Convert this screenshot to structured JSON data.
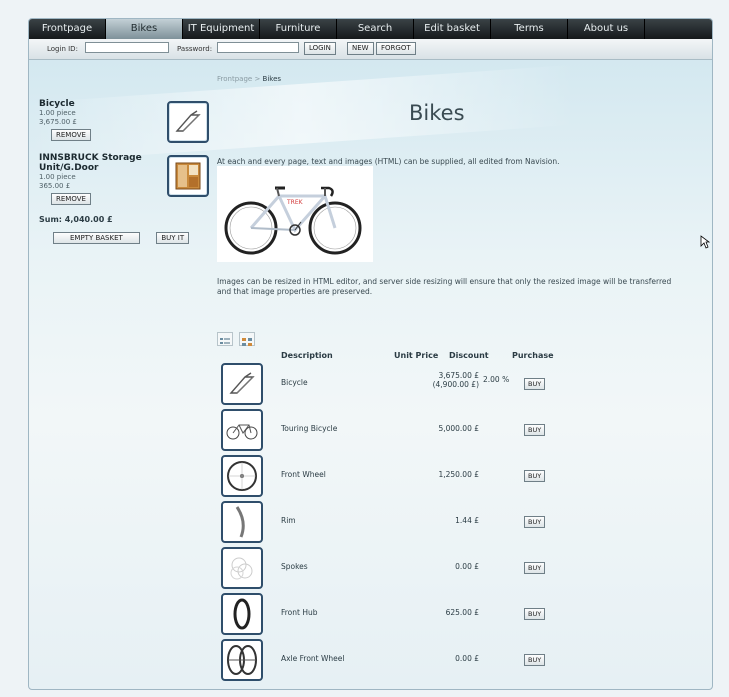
{
  "nav": {
    "items": [
      {
        "label": "Frontpage"
      },
      {
        "label": "Bikes"
      },
      {
        "label": "IT Equipment"
      },
      {
        "label": "Furniture"
      },
      {
        "label": "Search"
      },
      {
        "label": "Edit basket"
      },
      {
        "label": "Terms"
      },
      {
        "label": "About us"
      }
    ],
    "active": "Bikes"
  },
  "login": {
    "login_label": "Login ID:",
    "password_label": "Password:",
    "login_button": "LOGIN",
    "new_button": "NEW",
    "forgot_button": "FORGOT"
  },
  "breadcrumb": {
    "root": "Frontpage",
    "separator": ">",
    "current": "Bikes"
  },
  "page_title": "Bikes",
  "basket": {
    "items": [
      {
        "name": "Bicycle",
        "qty": "1.00 piece",
        "price": "3,675.00 £",
        "remove": "REMOVE",
        "icon": "bicycle-frame-icon"
      },
      {
        "name": "INNSBRUCK Storage Unit/G.Door",
        "qty": "1.00 piece",
        "price": "365.00 £",
        "remove": "REMOVE",
        "icon": "storage-cabinet-icon"
      }
    ],
    "sum": "Sum: 4,040.00 £",
    "empty_button": "EMPTY BASKET",
    "buy_button": "BUY IT"
  },
  "intro_text": "At each and every page, text and images (HTML) can be supplied, all edited from Navision.",
  "resize_text": "Images can be resized in HTML editor, and server side resizing will ensure that only the resized image will be transferred and that image properties are preserved.",
  "table": {
    "headers": {
      "description": "Description",
      "unit_price": "Unit Price",
      "discount": "Discount",
      "purchase": "Purchase"
    },
    "rows": [
      {
        "name": "Bicycle",
        "price": "3,675.00 £",
        "old_price": "(4,900.00 £)",
        "discount": "2.00 %",
        "buy": "BUY",
        "icon": "bicycle-frame-icon"
      },
      {
        "name": "Touring Bicycle",
        "price": "5,000.00 £",
        "buy": "BUY",
        "icon": "touring-bicycle-icon"
      },
      {
        "name": "Front Wheel",
        "price": "1,250.00 £",
        "buy": "BUY",
        "icon": "wheel-icon"
      },
      {
        "name": "Rim",
        "price": "1.44 £",
        "buy": "BUY",
        "icon": "rim-icon"
      },
      {
        "name": "Spokes",
        "price": "0.00 £",
        "buy": "BUY",
        "icon": "spokes-icon"
      },
      {
        "name": "Front Hub",
        "price": "625.00 £",
        "buy": "BUY",
        "icon": "hub-icon"
      },
      {
        "name": "Axle Front Wheel",
        "price": "0.00 £",
        "buy": "BUY",
        "icon": "axle-wheel-icon"
      }
    ]
  }
}
